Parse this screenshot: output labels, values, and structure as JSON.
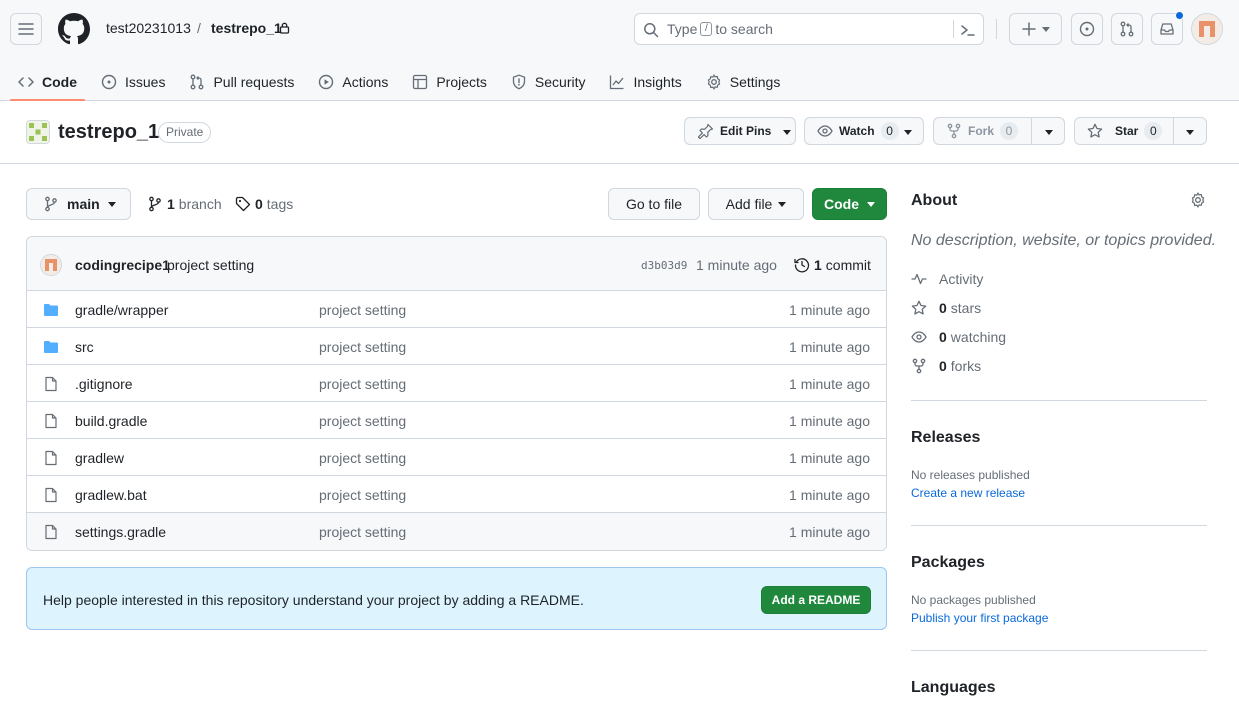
{
  "header": {
    "owner": "test20231013",
    "separator": "/",
    "repo": "testrepo_1",
    "search_prefix": "Type",
    "search_key": "/",
    "search_suffix": "to search"
  },
  "tabs": [
    {
      "label": "Code",
      "icon": "code-icon"
    },
    {
      "label": "Issues",
      "icon": "issue-icon"
    },
    {
      "label": "Pull requests",
      "icon": "pull-request-icon"
    },
    {
      "label": "Actions",
      "icon": "play-icon"
    },
    {
      "label": "Projects",
      "icon": "table-icon"
    },
    {
      "label": "Security",
      "icon": "shield-icon"
    },
    {
      "label": "Insights",
      "icon": "graph-icon"
    },
    {
      "label": "Settings",
      "icon": "gear-icon"
    }
  ],
  "repo_head": {
    "title": "testrepo_1",
    "visibility": "Private",
    "edit_pins": "Edit Pins",
    "watch": "Watch",
    "watch_count": "0",
    "fork": "Fork",
    "fork_count": "0",
    "star": "Star",
    "star_count": "0"
  },
  "toolbar": {
    "branch": "main",
    "branch_count": "1",
    "branch_label": "branch",
    "tag_count": "0",
    "tag_label": "tags",
    "go_to_file": "Go to file",
    "add_file": "Add file",
    "code": "Code"
  },
  "commit": {
    "author": "codingrecipe1",
    "message": "project setting",
    "sha": "d3b03d9",
    "time": "1 minute ago",
    "count": "1",
    "count_label": "commit"
  },
  "files": [
    {
      "name": "gradle/wrapper",
      "type": "folder",
      "message": "project setting",
      "time": "1 minute ago"
    },
    {
      "name": "src",
      "type": "folder",
      "message": "project setting",
      "time": "1 minute ago"
    },
    {
      "name": ".gitignore",
      "type": "file",
      "message": "project setting",
      "time": "1 minute ago"
    },
    {
      "name": "build.gradle",
      "type": "file",
      "message": "project setting",
      "time": "1 minute ago"
    },
    {
      "name": "gradlew",
      "type": "file",
      "message": "project setting",
      "time": "1 minute ago"
    },
    {
      "name": "gradlew.bat",
      "type": "file",
      "message": "project setting",
      "time": "1 minute ago"
    },
    {
      "name": "settings.gradle",
      "type": "file",
      "message": "project setting",
      "time": "1 minute ago"
    }
  ],
  "readme": {
    "message": "Help people interested in this repository understand your project by adding a README.",
    "button": "Add a README"
  },
  "sidebar": {
    "about_title": "About",
    "about_desc": "No description, website, or topics provided.",
    "activity": "Activity",
    "stars_count": "0",
    "stars_label": "stars",
    "watching_count": "0",
    "watching_label": "watching",
    "forks_count": "0",
    "forks_label": "forks",
    "releases_title": "Releases",
    "releases_sub": "No releases published",
    "releases_link": "Create a new release",
    "packages_title": "Packages",
    "packages_sub": "No packages published",
    "packages_link": "Publish your first package",
    "languages_title": "Languages"
  },
  "colors": {
    "primary_green": "#1f883d",
    "accent_underline": "#fd8c73",
    "link_blue": "#0969da",
    "folder_blue": "#54aeff",
    "readme_bg": "#ddf4ff"
  }
}
